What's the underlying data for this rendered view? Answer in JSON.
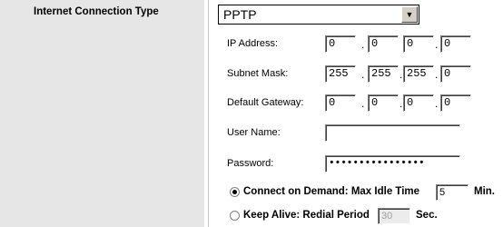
{
  "sidebar": {
    "section_title": "Internet Connection Type"
  },
  "connection_type": {
    "selected": "PPTP"
  },
  "fields": {
    "ip_address": {
      "label": "IP Address:",
      "octets": [
        "0",
        "0",
        "0",
        "0"
      ]
    },
    "subnet_mask": {
      "label": "Subnet Mask:",
      "octets": [
        "255",
        "255",
        "255",
        "0"
      ]
    },
    "default_gateway": {
      "label": "Default Gateway:",
      "octets": [
        "0",
        "0",
        "0",
        "0"
      ]
    },
    "user_name": {
      "label": "User Name:",
      "value": ""
    },
    "password": {
      "label": "Password:",
      "value": "••••••••••••••••"
    }
  },
  "separator": ".",
  "connect_on_demand": {
    "label": "Connect on Demand: Max Idle Time",
    "value": "5",
    "unit": "Min.",
    "selected": true
  },
  "keep_alive": {
    "label": "Keep Alive: Redial Period",
    "value": "30",
    "unit": "Sec.",
    "selected": false
  }
}
